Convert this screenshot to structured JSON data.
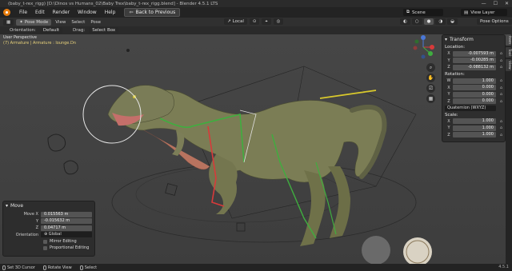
{
  "window": {
    "title": "(baby_t-rex_rigg) [D:\\Dinos vs Humans_02\\Baby Trex\\baby_t-rex_rigg.blend] - Blender 4.5.1 LTS",
    "controls": [
      "—",
      "☐",
      "✕"
    ]
  },
  "menubar": {
    "items": [
      "File",
      "Edit",
      "Render",
      "Window",
      "Help"
    ],
    "back_button": "Back to Previous",
    "scene_label": "Scene",
    "view_layer_label": "View Layer"
  },
  "header": {
    "mode": "Pose Mode",
    "menus": [
      "View",
      "Select",
      "Pose"
    ],
    "orientation_value": "Local",
    "pose_options": "Pose Options"
  },
  "toolbar_row": {
    "orientation_label": "Orientation:",
    "orientation_value": "Default",
    "drag_label": "Drag:",
    "drag_value": "Select Box"
  },
  "viewport": {
    "perspective": "User Perspective",
    "object_info": "(7) Armature | Armature : lounge.Dn"
  },
  "transform_panel": {
    "title": "Transform",
    "location_label": "Location:",
    "location": [
      {
        "axis": "X",
        "value": "-0.007593 m"
      },
      {
        "axis": "Y",
        "value": "-0.00285 m"
      },
      {
        "axis": "Z",
        "value": "-0.088132 m"
      }
    ],
    "rotation_label": "Rotation:",
    "rotation": [
      {
        "axis": "W",
        "value": "1.000"
      },
      {
        "axis": "X",
        "value": "0.000"
      },
      {
        "axis": "Y",
        "value": "0.000"
      },
      {
        "axis": "Z",
        "value": "0.000"
      }
    ],
    "rotation_mode": "Quaternion (WXYZ)",
    "scale_label": "Scale:",
    "scale": [
      {
        "axis": "X",
        "value": "1.000"
      },
      {
        "axis": "Y",
        "value": "1.000"
      },
      {
        "axis": "Z",
        "value": "1.000"
      }
    ]
  },
  "side_tabs": [
    "Item",
    "Tool",
    "View"
  ],
  "redo_panel": {
    "title": "Move",
    "move_x_label": "Move X",
    "move_x": "0.015563 m",
    "y_label": "Y",
    "y": "-0.015632 m",
    "z_label": "Z",
    "z": "0.04717 m",
    "orientation_label": "Orientation",
    "orientation_value": "Global",
    "mirror_editing": "Mirror Editing",
    "proportional_editing": "Proportional Editing"
  },
  "statusbar": {
    "items": [
      "Set 3D Cursor",
      "Rotate View",
      "Select"
    ],
    "version": "4.5.1"
  },
  "colors": {
    "accent": "#e87d0d",
    "panel": "#2e2e2e",
    "viewport": "#444444",
    "bone_green": "#3fae3f",
    "bone_red": "#d83a3a",
    "bone_yellow": "#d9c92c"
  },
  "icons": [
    "blender-logo-icon",
    "navigation-gizmo-icon",
    "zoom-icon",
    "pan-icon",
    "camera-icon",
    "perspective-icon",
    "lock-icon",
    "dinosaur-model"
  ]
}
